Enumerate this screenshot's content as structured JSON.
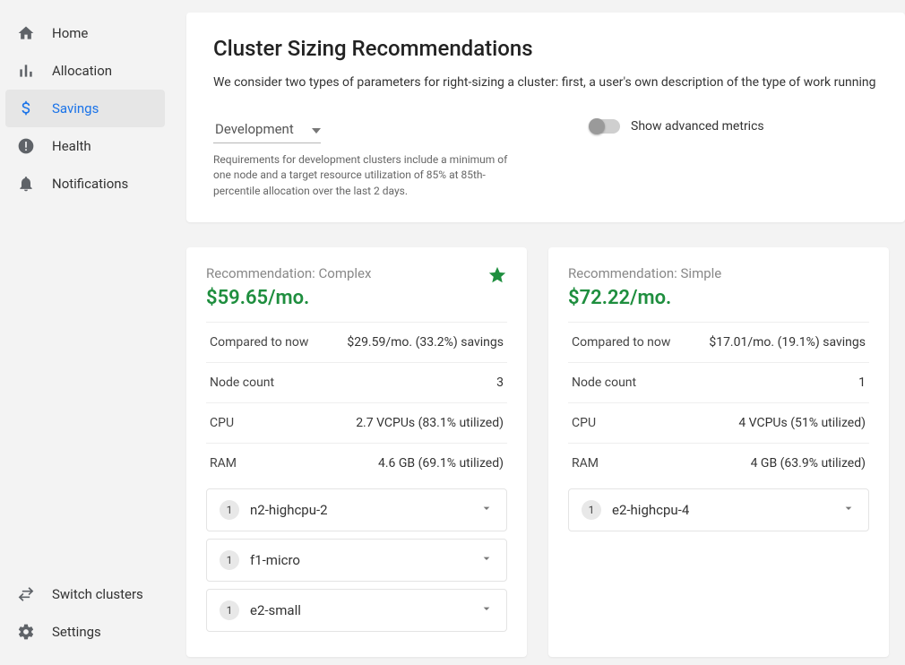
{
  "sidebar": {
    "top": [
      {
        "icon": "home",
        "label": "Home"
      },
      {
        "icon": "allocation",
        "label": "Allocation"
      },
      {
        "icon": "savings",
        "label": "Savings",
        "active": true
      },
      {
        "icon": "health",
        "label": "Health"
      },
      {
        "icon": "notifications",
        "label": "Notifications"
      }
    ],
    "bottom": [
      {
        "icon": "switch",
        "label": "Switch clusters"
      },
      {
        "icon": "settings",
        "label": "Settings"
      }
    ]
  },
  "header": {
    "title": "Cluster Sizing Recommendations",
    "description": "We consider two types of parameters for right-sizing a cluster: first, a user's own description of the type of work running on the availability); second, the \"shape\" of the workload, as measured by Kubecost metrics. We then consider different heuristic strate"
  },
  "profile": {
    "selected": "Development",
    "description": "Requirements for development clusters include a minimum of one node and a target resource utilization of 85% at 85th-percentile allocation over the last 2 days."
  },
  "advanced_metrics": {
    "label": "Show advanced metrics",
    "on": false
  },
  "cards": [
    {
      "label": "Recommendation: Complex",
      "starred": true,
      "price": "$59.65/mo.",
      "stats": [
        {
          "key": "Compared to now",
          "val": "$29.59/mo. (33.2%) savings"
        },
        {
          "key": "Node count",
          "val": "3"
        },
        {
          "key": "CPU",
          "val": "2.7 VCPUs (83.1% utilized)"
        },
        {
          "key": "RAM",
          "val": "4.6 GB (69.1% utilized)"
        }
      ],
      "pools": [
        {
          "count": "1",
          "name": "n2-highcpu-2"
        },
        {
          "count": "1",
          "name": "f1-micro"
        },
        {
          "count": "1",
          "name": "e2-small"
        }
      ]
    },
    {
      "label": "Recommendation: Simple",
      "starred": false,
      "price": "$72.22/mo.",
      "stats": [
        {
          "key": "Compared to now",
          "val": "$17.01/mo. (19.1%) savings"
        },
        {
          "key": "Node count",
          "val": "1"
        },
        {
          "key": "CPU",
          "val": "4 VCPUs (51% utilized)"
        },
        {
          "key": "RAM",
          "val": "4 GB (63.9% utilized)"
        }
      ],
      "pools": [
        {
          "count": "1",
          "name": "e2-highcpu-4"
        }
      ]
    }
  ]
}
